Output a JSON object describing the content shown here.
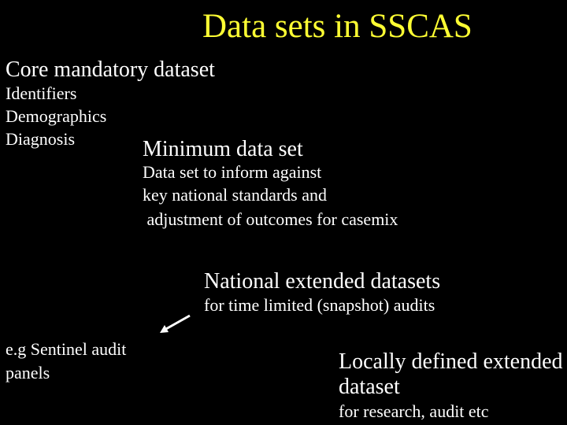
{
  "slide": {
    "title": "Data sets in SSCAS",
    "title_color": "#ffff33",
    "core": {
      "heading": "Core mandatory dataset",
      "items": [
        "Identifiers",
        "Demographics",
        "Diagnosis"
      ]
    },
    "minimum": {
      "heading": "Minimum data set",
      "lines": [
        "Data set to inform against",
        "key national standards and",
        " adjustment of outcomes for casemix"
      ]
    },
    "national": {
      "heading": "National extended datasets",
      "subtext": "for time limited (snapshot) audits"
    },
    "example": {
      "lines": [
        "e.g Sentinel audit",
        "panels"
      ]
    },
    "local": {
      "heading_lines": [
        "Locally defined extended",
        "dataset"
      ],
      "subtext": "for research, audit etc"
    },
    "arrow_icon": "arrow-down-left"
  }
}
